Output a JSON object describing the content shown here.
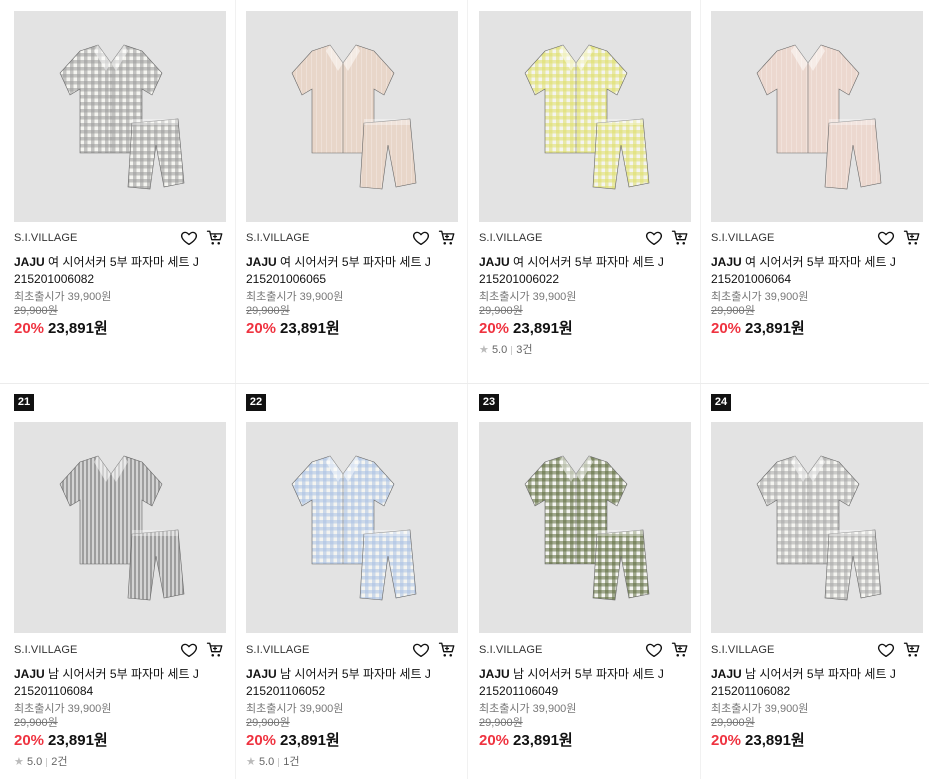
{
  "colors": {
    "discount": "#ef3340",
    "rank_bg": "#111111",
    "thumb_bg": "#e3e3e3"
  },
  "products": [
    {
      "rank": "",
      "brand": "S.I.VILLAGE",
      "title_brand": "JAJU",
      "title": "여 시어서커 5부 파자마 세트 J",
      "code": "215201006082",
      "orig_label": "최초출시가 39,900원",
      "strike_price": "29,900원",
      "discount": "20%",
      "price": "23,891원",
      "rating": "",
      "review_count": "",
      "pattern": "gray-check",
      "swatch": "#9a9a9a"
    },
    {
      "rank": "",
      "brand": "S.I.VILLAGE",
      "title_brand": "JAJU",
      "title": "여 시어서커 5부 파자마 세트 J",
      "code": "215201006065",
      "orig_label": "최초출시가 39,900원",
      "strike_price": "29,900원",
      "discount": "20%",
      "price": "23,891원",
      "rating": "",
      "review_count": "",
      "pattern": "beige",
      "swatch": "#e8d6c9"
    },
    {
      "rank": "",
      "brand": "S.I.VILLAGE",
      "title_brand": "JAJU",
      "title": "여 시어서커 5부 파자마 세트 J",
      "code": "215201006022",
      "orig_label": "최초출시가 39,900원",
      "strike_price": "29,900원",
      "discount": "20%",
      "price": "23,891원",
      "rating": "5.0",
      "review_count": "3건",
      "pattern": "yellow-check",
      "swatch": "#dedd6a"
    },
    {
      "rank": "",
      "brand": "S.I.VILLAGE",
      "title_brand": "JAJU",
      "title": "여 시어서커 5부 파자마 세트 J",
      "code": "215201006064",
      "orig_label": "최초출시가 39,900원",
      "strike_price": "29,900원",
      "discount": "20%",
      "price": "23,891원",
      "rating": "",
      "review_count": "",
      "pattern": "pink",
      "swatch": "#ecd8cf"
    },
    {
      "rank": "21",
      "brand": "S.I.VILLAGE",
      "title_brand": "JAJU",
      "title": "남 시어서커 5부 파자마 세트 J",
      "code": "215201106084",
      "orig_label": "최초출시가 39,900원",
      "strike_price": "29,900원",
      "discount": "20%",
      "price": "23,891원",
      "rating": "5.0",
      "review_count": "2건",
      "pattern": "gray-stripe",
      "swatch": "#9e9e9e"
    },
    {
      "rank": "22",
      "brand": "S.I.VILLAGE",
      "title_brand": "JAJU",
      "title": "남 시어서커 5부 파자마 세트 J",
      "code": "215201106052",
      "orig_label": "최초출시가 39,900원",
      "strike_price": "29,900원",
      "discount": "20%",
      "price": "23,891원",
      "rating": "5.0",
      "review_count": "1건",
      "pattern": "blue-check",
      "swatch": "#a9c0e3"
    },
    {
      "rank": "23",
      "brand": "S.I.VILLAGE",
      "title_brand": "JAJU",
      "title": "남 시어서커 5부 파자마 세트 J",
      "code": "215201106049",
      "orig_label": "최초출시가 39,900원",
      "strike_price": "29,900원",
      "discount": "20%",
      "price": "23,891원",
      "rating": "",
      "review_count": "",
      "pattern": "green-check",
      "swatch": "#5c6b3e"
    },
    {
      "rank": "24",
      "brand": "S.I.VILLAGE",
      "title_brand": "JAJU",
      "title": "남 시어서커 5부 파자마 세트 J",
      "code": "215201106082",
      "orig_label": "최초출시가 39,900원",
      "strike_price": "29,900원",
      "discount": "20%",
      "price": "23,891원",
      "rating": "",
      "review_count": "",
      "pattern": "gray-check-light",
      "swatch": "#a8a8a8"
    }
  ],
  "icons": {
    "wishlist": "heart-icon",
    "cart": "cart-icon",
    "rating": "star-icon"
  }
}
